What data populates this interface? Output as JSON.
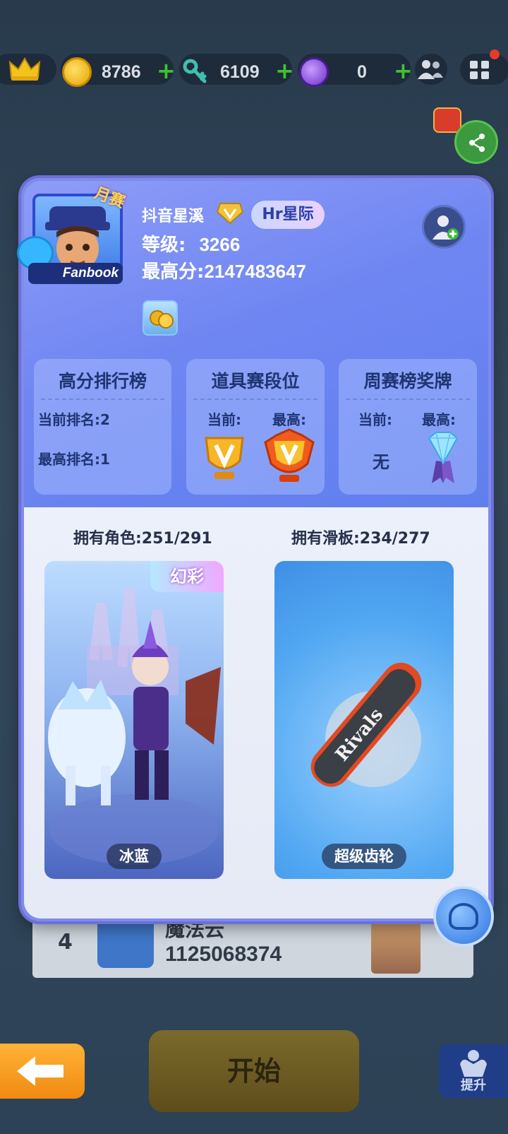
{
  "topbar": {
    "coins": "8786",
    "keys": "6109",
    "tokens": "0",
    "icons": [
      "crown-icon",
      "coin-icon",
      "key-icon",
      "token-icon",
      "friends-icon",
      "menu-icon"
    ]
  },
  "profile": {
    "badge_month": "月赛",
    "fanbook": "Fanbook",
    "name": "抖音星溪",
    "tag": "Hr星际",
    "level_label": "等级:",
    "level_value": "3266",
    "best_label": "最高分:",
    "best_value": "2147483647"
  },
  "stats": {
    "leaderboard": {
      "title": "高分排行榜",
      "current": "当前排名:2",
      "best": "最高排名:1"
    },
    "item_rank": {
      "title": "道具赛段位",
      "current_label": "当前:",
      "best_label": "最高:"
    },
    "weekly_medal": {
      "title": "周赛榜奖牌",
      "current_label": "当前:",
      "best_label": "最高:",
      "current_value": "无"
    }
  },
  "collection": {
    "characters_label": "拥有角色:251/291",
    "boards_label": "拥有滑板:234/277",
    "character_name": "冰蓝",
    "character_tag": "幻彩",
    "board_name": "超级齿轮",
    "board_print": "Rivals"
  },
  "background": {
    "rank": "4",
    "player": "魔法云",
    "score": "1125068374"
  },
  "bottom": {
    "start": "开始",
    "upgrade": "提升"
  },
  "colors": {
    "plus_green": "#3ec22f",
    "card_blue": "#6f86f2",
    "start_yellow": "#ffc23a"
  }
}
